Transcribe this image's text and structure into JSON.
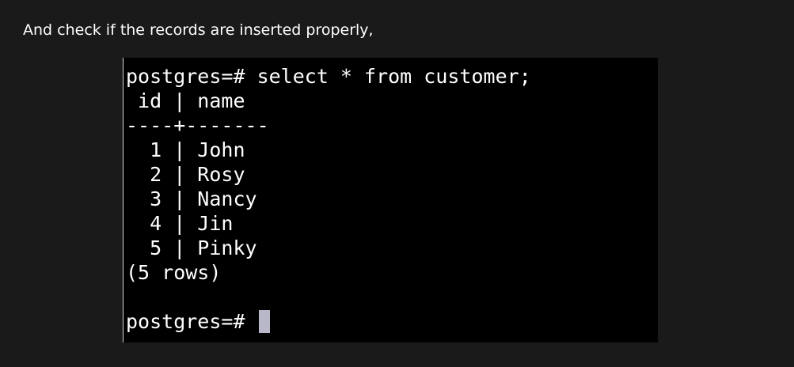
{
  "intro": {
    "text": "And check if the records are inserted properly,"
  },
  "terminal": {
    "command": "postgres=# select * from customer;",
    "header": " id | name",
    "separator": "----+-------",
    "rows": [
      "  1 | John",
      "  2 | Rosy",
      "  3 | Nancy",
      "  4 | Jin",
      "  5 | Pinky"
    ],
    "row_count": "(5 rows)",
    "prompt": "postgres=# "
  }
}
